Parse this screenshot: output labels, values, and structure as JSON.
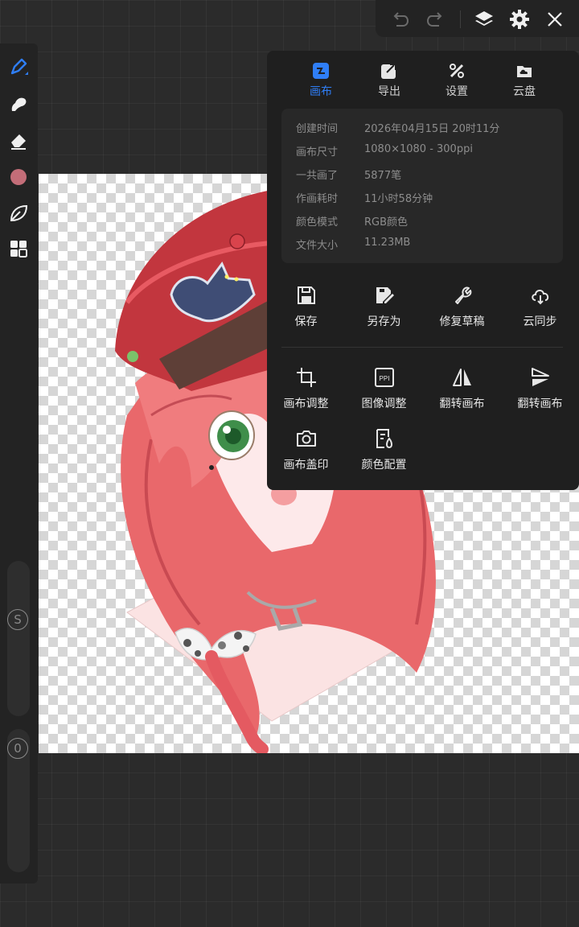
{
  "toolbar": {
    "tools": [
      "brush-icon",
      "smudge-icon",
      "eraser-icon",
      "color",
      "leaf-icon",
      "panels-icon"
    ],
    "current_color": "#c36d78",
    "size_slider_label": "S",
    "opacity_slider_label": "0"
  },
  "top_actions": {
    "items": [
      "undo-icon",
      "redo-icon",
      "layers-icon",
      "settings-icon",
      "close-icon"
    ]
  },
  "panel": {
    "tabs": [
      {
        "label": "画布",
        "icon": "canvas-icon",
        "active": true
      },
      {
        "label": "导出",
        "icon": "export-icon",
        "active": false
      },
      {
        "label": "设置",
        "icon": "tools-icon",
        "active": false
      },
      {
        "label": "云盘",
        "icon": "cloud-drive-icon",
        "active": false
      }
    ],
    "info": [
      {
        "label": "创建时间",
        "value": "2026年04月15日 20时11分"
      },
      {
        "label": "画布尺寸",
        "value": "1080×1080 - 300ppi"
      },
      {
        "label": "一共画了",
        "value": "5877笔"
      },
      {
        "label": "作画耗时",
        "value": "11小时58分钟"
      },
      {
        "label": "颜色模式",
        "value": "RGB颜色"
      },
      {
        "label": "文件大小",
        "value": "11.23MB"
      }
    ],
    "actions_row1": [
      {
        "label": "保存",
        "icon": "save-icon"
      },
      {
        "label": "另存为",
        "icon": "save-as-icon"
      },
      {
        "label": "修复草稿",
        "icon": "wrench-icon"
      },
      {
        "label": "云同步",
        "icon": "cloud-sync-icon"
      }
    ],
    "actions_row2": [
      {
        "label": "画布调整",
        "icon": "crop-icon"
      },
      {
        "label": "图像调整",
        "icon": "ppi-icon",
        "icon_text": "PPI"
      },
      {
        "label": "翻转画布",
        "icon": "flip-horizontal-icon"
      },
      {
        "label": "翻转画布",
        "icon": "flip-vertical-icon"
      }
    ],
    "actions_row3": [
      {
        "label": "画布盖印",
        "icon": "camera-stamp-icon"
      },
      {
        "label": "颜色配置",
        "icon": "color-profile-icon"
      }
    ]
  },
  "colors": {
    "accent": "#2f7ef6",
    "panel_bg": "#1f1f1f"
  }
}
